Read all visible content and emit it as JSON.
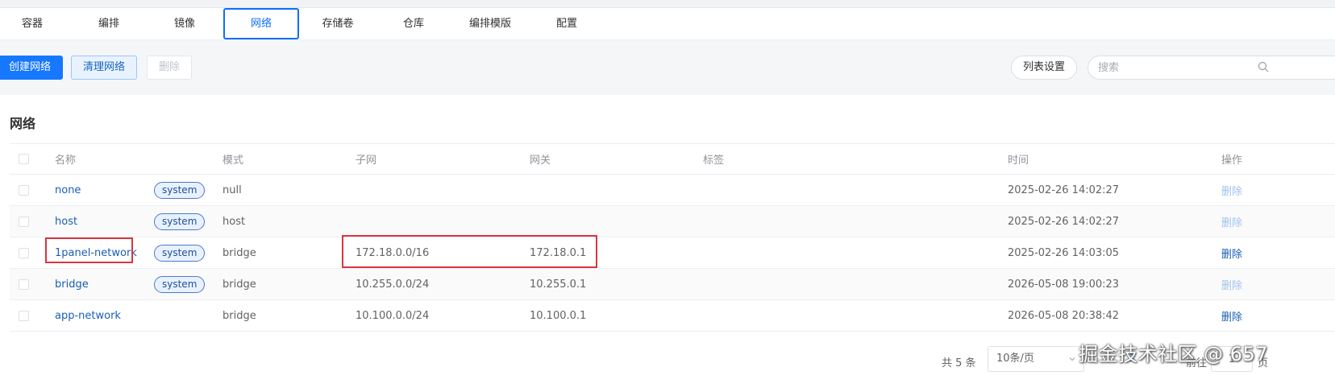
{
  "tabs": [
    {
      "label": "容器"
    },
    {
      "label": "编排"
    },
    {
      "label": "镜像"
    },
    {
      "label": "网络"
    },
    {
      "label": "存储卷"
    },
    {
      "label": "仓库"
    },
    {
      "label": "编排模版"
    },
    {
      "label": "配置"
    }
  ],
  "active_tab": "网络",
  "toolbar": {
    "create_label": "创建网络",
    "prune_label": "清理网络",
    "delete_label": "删除",
    "list_settings_label": "列表设置",
    "search_placeholder": "搜索"
  },
  "section": {
    "title": "网络"
  },
  "table": {
    "headers": {
      "name": "名称",
      "mode": "模式",
      "subnet": "子网",
      "gateway": "网关",
      "labels": "标签",
      "time": "时间",
      "ops": "操作"
    },
    "rows": [
      {
        "name": "none",
        "tag": "system",
        "mode": "null",
        "subnet": "",
        "gateway": "",
        "time": "2025-02-26 14:02:27",
        "op": "删除",
        "op_enabled": false
      },
      {
        "name": "host",
        "tag": "system",
        "mode": "host",
        "subnet": "",
        "gateway": "",
        "time": "2025-02-26 14:02:27",
        "op": "删除",
        "op_enabled": false
      },
      {
        "name": "1panel-network",
        "tag": "system",
        "mode": "bridge",
        "subnet": "172.18.0.0/16",
        "gateway": "172.18.0.1",
        "time": "2025-02-26 14:03:05",
        "op": "删除",
        "op_enabled": true
      },
      {
        "name": "bridge",
        "tag": "system",
        "mode": "bridge",
        "subnet": "10.255.0.0/24",
        "gateway": "10.255.0.1",
        "time": "2026-05-08 19:00:23",
        "op": "删除",
        "op_enabled": false
      },
      {
        "name": "app-network",
        "tag": "",
        "mode": "bridge",
        "subnet": "10.100.0.0/24",
        "gateway": "10.100.0.1",
        "time": "2026-05-08 20:38:42",
        "op": "删除",
        "op_enabled": true
      }
    ]
  },
  "pagination": {
    "total_text": "共 5 条",
    "page_size": "10条/页",
    "current_page": "1",
    "goto_label": "前往",
    "goto_value": "1",
    "goto_suffix": "页"
  },
  "watermark": "掘金技术社区 @ 657",
  "colors": {
    "accent": "#1677ff",
    "link": "#1a5fb4",
    "highlight": "#d9363e"
  }
}
